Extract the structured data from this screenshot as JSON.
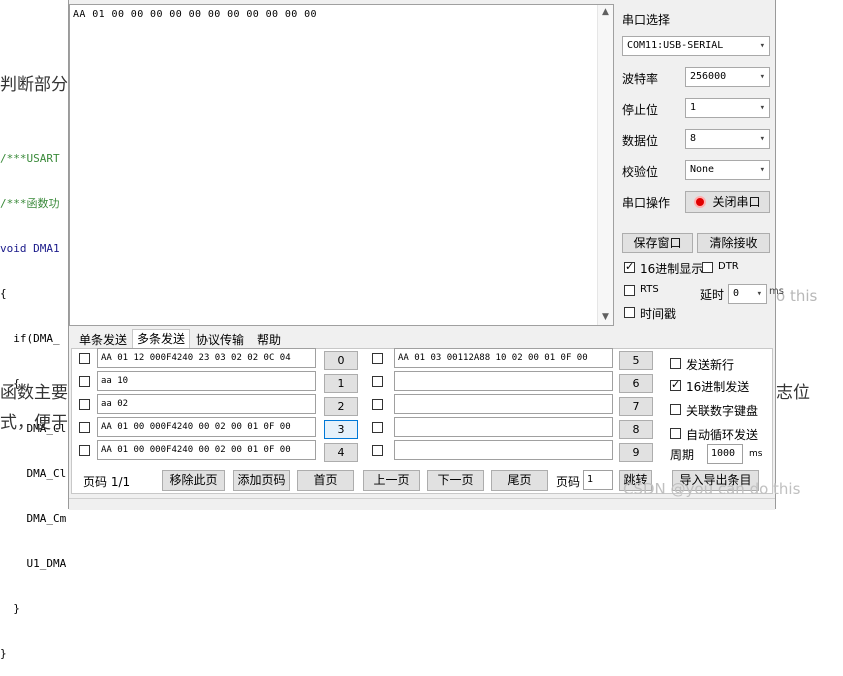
{
  "background": {
    "heading_fragment": "判断部分",
    "code_lines": [
      "/***USART",
      "/***函数功",
      "void DMA1",
      "{",
      "  if(DMA_",
      "  {",
      "    DMA_Cl",
      "    DMA_Cl",
      "    DMA_Cm",
      "    U1_DMA",
      "  }",
      "}"
    ],
    "body_left_1": "函数主要",
    "body_left_2": "式，便于",
    "body_right": "志位",
    "side_right": "o this"
  },
  "receive": {
    "content": "AA 01 00 00 00 00 00 00 00 00 00 00 00"
  },
  "port": {
    "port_select_label": "串口选择",
    "port_value": "COM11:USB-SERIAL",
    "baud_label": "波特率",
    "baud_value": "256000",
    "stop_label": "停止位",
    "stop_value": "1",
    "data_label": "数据位",
    "data_value": "8",
    "parity_label": "校验位",
    "parity_value": "None",
    "op_label": "串口操作",
    "op_button": "关闭串口"
  },
  "actions": {
    "save_window": "保存窗口",
    "clear_receive": "清除接收",
    "hex_display": "16进制显示",
    "dtr": "DTR",
    "rts": "RTS",
    "delay_label": "延时",
    "delay_value": "0",
    "delay_unit": "ms",
    "timestamp": "时间戳"
  },
  "tabs": [
    "单条发送",
    "多条发送",
    "协议传输",
    "帮助"
  ],
  "multi_send": {
    "left_rows": [
      {
        "value": "AA 01 12 000F4240 23 03 02 02 0C 04",
        "num": "0"
      },
      {
        "value": "aa 10",
        "num": "1"
      },
      {
        "value": "aa 02",
        "num": "2"
      },
      {
        "value": "AA 01 00 000F4240 00 02 00 01 0F 00",
        "num": "3"
      },
      {
        "value": "AA 01 00 000F4240 00 02 00 01 0F 00",
        "num": "4"
      }
    ],
    "right_rows": [
      {
        "value": "AA 01 03 00112A88 10 02 00 01 0F 00",
        "num": "5"
      },
      {
        "value": "",
        "num": "6"
      },
      {
        "value": "",
        "num": "7"
      },
      {
        "value": "",
        "num": "8"
      },
      {
        "value": "",
        "num": "9"
      }
    ],
    "send_newline": "发送新行",
    "hex_send": "16进制发送",
    "link_keyboard": "关联数字键盘",
    "auto_loop": "自动循环发送",
    "period_label": "周期",
    "period_value": "1000",
    "period_unit": "ms"
  },
  "pager": {
    "page_label": "页码 1/1",
    "remove_page": "移除此页",
    "add_page": "添加页码",
    "first": "首页",
    "prev": "上一页",
    "next": "下一页",
    "last": "尾页",
    "page_input_label": "页码",
    "page_input_value": "1",
    "jump": "跳转",
    "import_export": "导入导出条目"
  },
  "watermark": "CSDN @you can do this"
}
